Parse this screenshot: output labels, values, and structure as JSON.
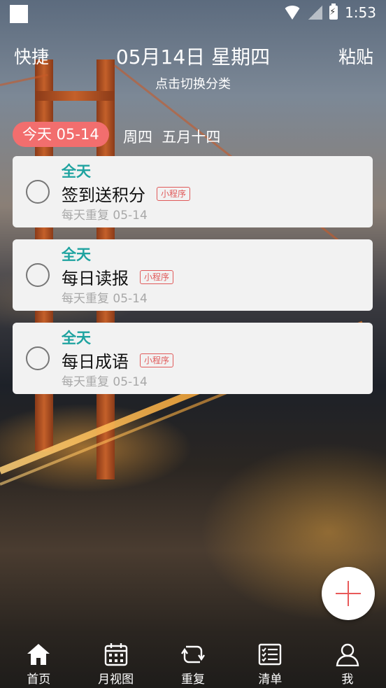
{
  "status_bar": {
    "time": "1:53"
  },
  "header": {
    "left_label": "快捷",
    "title": "05月14日 星期四",
    "subtitle": "点击切换分类",
    "right_label": "粘贴"
  },
  "date_bar": {
    "today_pill": "今天 05-14",
    "weekday": "周四",
    "lunar_date": "五月十四"
  },
  "tasks": [
    {
      "time_label": "全天",
      "title": "签到送积分",
      "tag": "小程序",
      "repeat": "每天重复 05-14"
    },
    {
      "time_label": "全天",
      "title": "每日读报",
      "tag": "小程序",
      "repeat": "每天重复 05-14"
    },
    {
      "time_label": "全天",
      "title": "每日成语",
      "tag": "小程序",
      "repeat": "每天重复 05-14"
    }
  ],
  "bottom_nav": [
    {
      "label": "首页",
      "icon": "home-icon"
    },
    {
      "label": "月视图",
      "icon": "calendar-icon"
    },
    {
      "label": "重复",
      "icon": "repeat-icon"
    },
    {
      "label": "清单",
      "icon": "checklist-icon"
    },
    {
      "label": "我",
      "icon": "profile-icon"
    }
  ],
  "colors": {
    "accent_red": "#f26e6e",
    "allday_teal": "#1fa3a0",
    "tag_red": "#e05a5a",
    "card_bg": "#f2f2f2"
  }
}
